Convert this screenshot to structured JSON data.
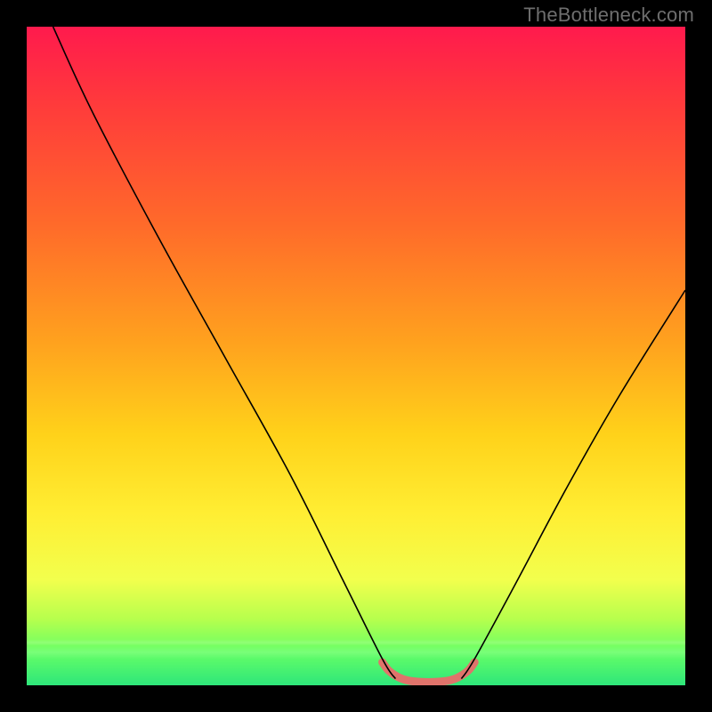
{
  "watermark": "TheBottleneck.com",
  "chart_data": {
    "type": "line",
    "title": "",
    "xlabel": "",
    "ylabel": "",
    "xlim": [
      0,
      100
    ],
    "ylim": [
      0,
      100
    ],
    "grid": false,
    "legend": false,
    "series": [
      {
        "name": "bottleneck-curve-left",
        "stroke": "#000000",
        "stroke_width": 1.6,
        "x": [
          4,
          10,
          20,
          30,
          40,
          48,
          54,
          56
        ],
        "values": [
          100,
          87,
          68,
          50,
          32,
          16,
          4,
          1
        ]
      },
      {
        "name": "bottleneck-curve-right",
        "stroke": "#000000",
        "stroke_width": 1.6,
        "x": [
          66,
          68,
          74,
          82,
          90,
          100
        ],
        "values": [
          1,
          4,
          15,
          30,
          44,
          60
        ]
      },
      {
        "name": "optimal-zone-highlight",
        "stroke": "#e0736b",
        "stroke_width": 9,
        "linecap": "round",
        "x": [
          54,
          55,
          56.5,
          58,
          60,
          62,
          64,
          65.5,
          67,
          68
        ],
        "values": [
          3.5,
          2.2,
          1.2,
          0.7,
          0.5,
          0.5,
          0.7,
          1.2,
          2.2,
          3.5
        ]
      }
    ],
    "background_gradient": {
      "orientation": "vertical",
      "stops": [
        {
          "pos": 0.0,
          "color": "#ff1a4d"
        },
        {
          "pos": 0.12,
          "color": "#ff3b3b"
        },
        {
          "pos": 0.3,
          "color": "#ff6a2a"
        },
        {
          "pos": 0.48,
          "color": "#ffa21e"
        },
        {
          "pos": 0.62,
          "color": "#ffd21a"
        },
        {
          "pos": 0.74,
          "color": "#ffee33"
        },
        {
          "pos": 0.84,
          "color": "#f2ff4d"
        },
        {
          "pos": 0.9,
          "color": "#b6ff4d"
        },
        {
          "pos": 0.95,
          "color": "#66ff66"
        },
        {
          "pos": 1.0,
          "color": "#2ee67a"
        }
      ]
    }
  }
}
